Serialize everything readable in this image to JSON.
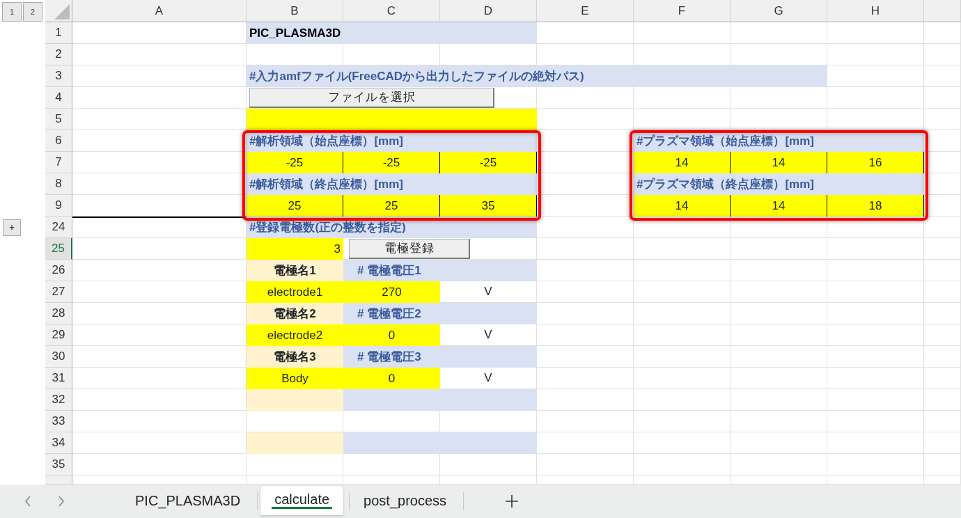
{
  "outline_levels": [
    "1",
    "2"
  ],
  "columns": [
    "A",
    "B",
    "C",
    "D",
    "E",
    "F",
    "G",
    "H"
  ],
  "rows": [
    {
      "number": "1",
      "selected": false,
      "cells": [
        {
          "kind": "title",
          "text": "PIC_PLASMA3D"
        }
      ]
    },
    {
      "number": "2",
      "selected": false,
      "cells": []
    },
    {
      "number": "3",
      "selected": false,
      "cells": [
        {
          "kind": "heading",
          "text": "#入力amfファイル(FreeCADから出力したファイルの絶対パス)"
        }
      ]
    },
    {
      "number": "4",
      "selected": false,
      "cells": [
        {
          "kind": "button",
          "text": "ファイルを選択"
        }
      ]
    },
    {
      "number": "5",
      "selected": false,
      "cells": [
        {
          "kind": "input_fill"
        }
      ]
    },
    {
      "number": "6",
      "selected": false,
      "cells": [
        {
          "kind": "heading",
          "text": "#解析領域（始点座標）[mm]"
        },
        {
          "kind": "heading",
          "text": "#プラズマ領域（始点座標）[mm]"
        }
      ]
    },
    {
      "number": "7",
      "selected": false,
      "cells": [
        {
          "kind": "boxed_value",
          "text": "-25"
        },
        {
          "kind": "boxed_value",
          "text": "-25"
        },
        {
          "kind": "boxed_value",
          "text": "-25"
        },
        {
          "kind": "boxed_value",
          "text": "14"
        },
        {
          "kind": "boxed_value",
          "text": "14"
        },
        {
          "kind": "boxed_value",
          "text": "16"
        }
      ]
    },
    {
      "number": "8",
      "selected": false,
      "cells": [
        {
          "kind": "heading",
          "text": "#解析領域（終点座標）[mm]"
        },
        {
          "kind": "heading",
          "text": "#プラズマ領域（終点座標）[mm]"
        }
      ]
    },
    {
      "number": "9",
      "selected": false,
      "cells": [
        {
          "kind": "boxed_value",
          "text": "25"
        },
        {
          "kind": "boxed_value",
          "text": "25"
        },
        {
          "kind": "boxed_value",
          "text": "35"
        },
        {
          "kind": "boxed_value",
          "text": "14"
        },
        {
          "kind": "boxed_value",
          "text": "14"
        },
        {
          "kind": "boxed_value",
          "text": "18"
        }
      ]
    },
    {
      "number": "24",
      "selected": false,
      "outline_button": "+",
      "cells": [
        {
          "kind": "heading",
          "text": "#登録電極数(正の整数を指定)"
        }
      ]
    },
    {
      "number": "25",
      "selected": true,
      "cells": [
        {
          "kind": "count",
          "text": "3"
        },
        {
          "kind": "button",
          "text": "電極登録"
        }
      ]
    },
    {
      "number": "26",
      "selected": false,
      "cells": [
        {
          "kind": "name_label",
          "text": "電極名1"
        },
        {
          "kind": "voltage_label",
          "text": "# 電極電圧1"
        }
      ]
    },
    {
      "number": "27",
      "selected": false,
      "cells": [
        {
          "kind": "value",
          "text": "electrode1"
        },
        {
          "kind": "value",
          "text": "270"
        },
        {
          "kind": "unit",
          "text": "V"
        }
      ]
    },
    {
      "number": "28",
      "selected": false,
      "cells": [
        {
          "kind": "name_label",
          "text": "電極名2"
        },
        {
          "kind": "voltage_label",
          "text": "# 電極電圧2"
        }
      ]
    },
    {
      "number": "29",
      "selected": false,
      "cells": [
        {
          "kind": "value",
          "text": "electrode2"
        },
        {
          "kind": "value",
          "text": "0"
        },
        {
          "kind": "unit",
          "text": "V"
        }
      ]
    },
    {
      "number": "30",
      "selected": false,
      "cells": [
        {
          "kind": "name_label",
          "text": "電極名3"
        },
        {
          "kind": "voltage_label",
          "text": "# 電極電圧3"
        }
      ]
    },
    {
      "number": "31",
      "selected": false,
      "cells": [
        {
          "kind": "value",
          "text": "Body"
        },
        {
          "kind": "value",
          "text": "0"
        },
        {
          "kind": "unit",
          "text": "V"
        }
      ]
    },
    {
      "number": "32",
      "selected": false,
      "cells": [
        {
          "kind": "name_fill"
        },
        {
          "kind": "heading_fill"
        }
      ]
    },
    {
      "number": "33",
      "selected": false,
      "cells": []
    },
    {
      "number": "34",
      "selected": false,
      "cells": [
        {
          "kind": "name_fill"
        },
        {
          "kind": "heading_fill"
        }
      ]
    },
    {
      "number": "35",
      "selected": false,
      "cells": []
    }
  ],
  "sheet_tabs": [
    {
      "label": "PIC_PLASMA3D",
      "selected": false
    },
    {
      "label": "calculate",
      "selected": true
    },
    {
      "label": "post_process",
      "selected": false
    }
  ]
}
